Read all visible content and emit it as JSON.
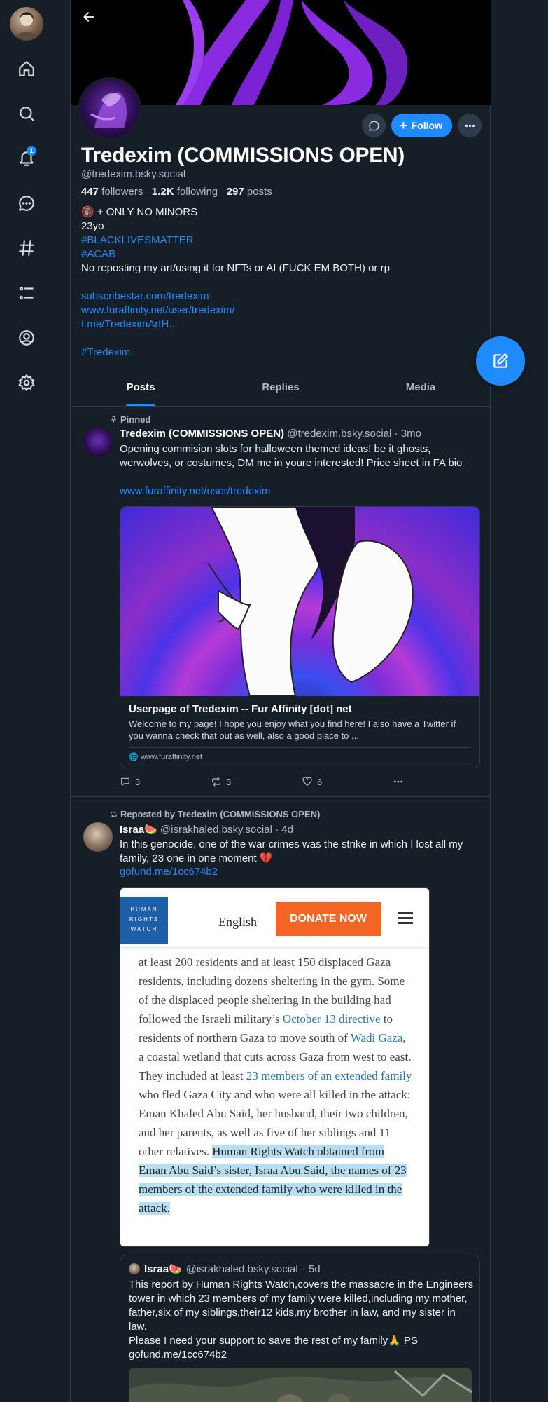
{
  "nav": {
    "notification_count": "1"
  },
  "profile": {
    "display_name": "Tredexim (COMMISSIONS OPEN)",
    "handle": "@tredexim.bsky.social",
    "followers_count": "447",
    "followers_label": "followers",
    "following_count": "1.2K",
    "following_label": "following",
    "posts_count": "297",
    "posts_label": "posts",
    "follow_label": "Follow",
    "bio": {
      "line1": "🔞 + ONLY NO MINORS",
      "line2": "23yo",
      "line3": "#BLACKLIVESMATTER",
      "line4": "#ACAB",
      "line5": "No reposting my art/using it for NFTs or AI (FUCK EM BOTH) or  rp",
      "link1": "subscribestar.com/tredexim",
      "link2": "www.furaffinity.net/user/tredexim/",
      "link3": "t.me/TredeximArtH...",
      "tag": "#Tredexim"
    }
  },
  "tabs": [
    "Posts",
    "Replies",
    "Media"
  ],
  "pinned_post": {
    "pinned_label": "Pinned",
    "author": "Tredexim (COMMISSIONS OPEN)",
    "handle": "@tredexim.bsky.social",
    "time": "· 3mo",
    "text": "Opening commision slots for halloween themed ideas! be it ghosts, werwolves, or costumes, DM me in youre interested! Price sheet in FA bio",
    "link": "www.furaffinity.net/user/tredexim",
    "card": {
      "title": "Userpage of Tredexim -- Fur Affinity [dot] net",
      "description": "Welcome to my page! I hope you enjoy what you find here! I also have a Twitter if you wanna check that out as well, also a good place to ...",
      "domain": "🌐 www.furaffinity.net"
    },
    "replies": "3",
    "reposts": "3",
    "likes": "6"
  },
  "repost": {
    "repost_label": "Reposted by Tredexim (COMMISSIONS OPEN)",
    "author": "Israa🍉",
    "handle": "@israkhaled.bsky.social",
    "time": "· 4d",
    "text": "In this genocide, one of the war crimes was the strike in which I lost all my family, 23 one in one moment 💔",
    "link": "gofund.me/1cc674b2",
    "image": {
      "logo_lines": [
        "HUMAN",
        "RIGHTS",
        "WATCH"
      ],
      "language": "English",
      "donate": "DONATE NOW",
      "p1": "at least 200 residents and at least 150 displaced Gaza residents, including dozens sheltering in the gym. Some of the displaced people sheltering in the building had followed the Israeli military’s ",
      "lk1": "October 13 directive",
      "p2": " to residents of northern Gaza to move south of ",
      "lk2": "Wadi Gaza",
      "p3": ", a coastal wetland that cuts across Gaza from west to east. They included at least ",
      "lk3": "23 members of an extended family",
      "p4": " who fled Gaza City and who were all killed in the attack: Eman Khaled Abu Said, her husband, their two children, and her parents, as well as five of her siblings and 11 other relatives. ",
      "hl": "Human Rights Watch obtained from Eman Abu Said’s sister, Israa Abu Said, the names of 23 members of the extended family who were killed in the attack."
    },
    "quote": {
      "author": "Israa🍉",
      "handle": "@israkhaled.bsky.social",
      "time": "· 5d",
      "text1": "This report by Human Rights Watch,covers the massacre in the Engineers tower in which 23 members of my family were killed,including my mother, father,six of my siblings,their12 kids,my brother in law, and my sister in law.",
      "text2": "Please I need your support to save the rest of my family🙏 PS",
      "link": "gofund.me/1cc674b2"
    }
  },
  "colors": {
    "background": "#161e27",
    "accent": "#208bfe",
    "banner_purple": "#8a2be2",
    "donate_orange": "#f26522"
  }
}
